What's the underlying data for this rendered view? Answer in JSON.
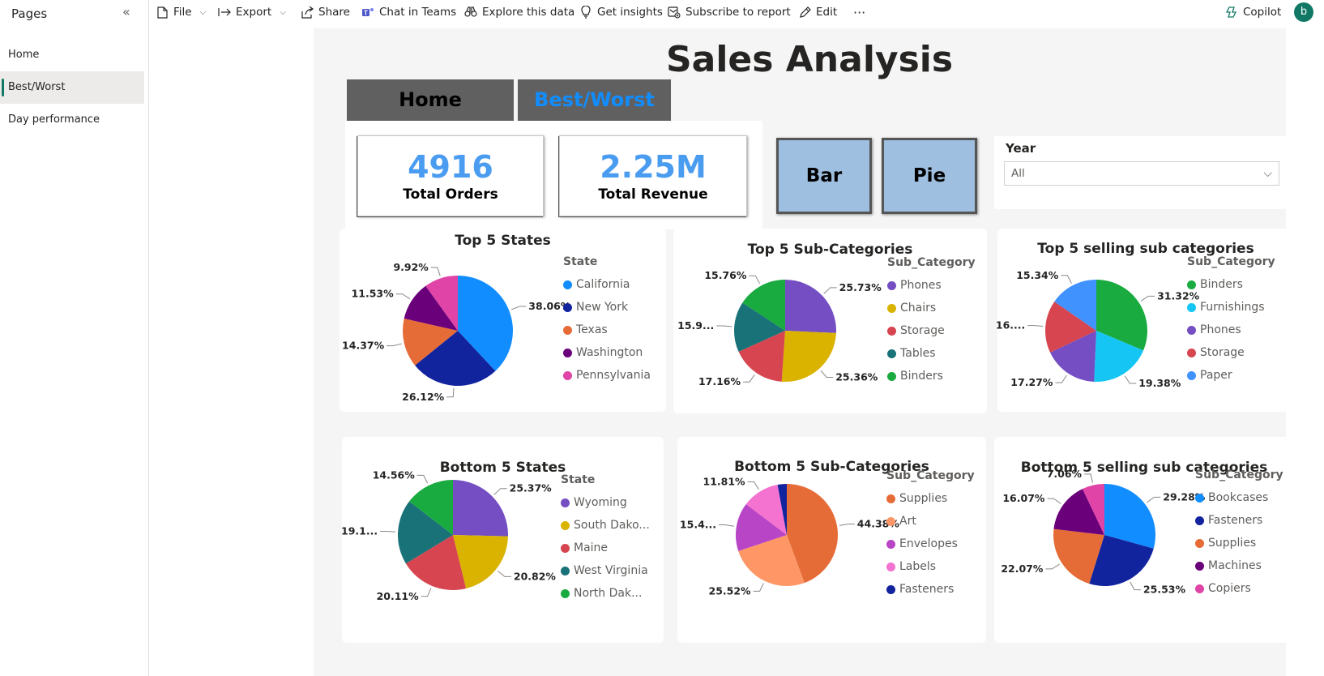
{
  "sidebar": {
    "title": "Pages",
    "items": [
      {
        "label": "Home",
        "active": false
      },
      {
        "label": "Best/Worst",
        "active": true
      },
      {
        "label": "Day performance",
        "active": false
      }
    ]
  },
  "toolbar": {
    "file": "File",
    "export": "Export",
    "share": "Share",
    "chat": "Chat in Teams",
    "explore": "Explore this data",
    "insights": "Get insights",
    "subscribe": "Subscribe to report",
    "edit": "Edit",
    "more": "···",
    "copilot": "Copilot",
    "avatar": "b"
  },
  "report": {
    "title": "Sales Analysis",
    "nav": {
      "home": "Home",
      "bestworst": "Best/Worst"
    },
    "kpis": [
      {
        "value": "4916",
        "label": "Total Orders"
      },
      {
        "value": "2.25M",
        "label": "Total Revenue"
      }
    ],
    "toggles": {
      "bar": "Bar",
      "pie": "Pie"
    },
    "slicer": {
      "title": "Year",
      "value": "All"
    }
  },
  "colors": {
    "accent": "#118dff",
    "kpi_value": "#4a9cf0",
    "toggle_bg": "#9fbfe0",
    "nav_bg": "#606060",
    "brand": "#117865"
  },
  "chart_data": [
    {
      "type": "pie",
      "title": "Top 5 States",
      "legend_title": "State",
      "categories": [
        "California",
        "New York",
        "Texas",
        "Washington",
        "Pennsylvania"
      ],
      "values": [
        38.06,
        26.12,
        14.37,
        11.53,
        9.92
      ],
      "labels": [
        "38.06%",
        "26.12%",
        "14.37%",
        "11.53%",
        "9.92%"
      ],
      "colors": [
        "#118dff",
        "#12239e",
        "#e66c37",
        "#6b007b",
        "#e044a7"
      ]
    },
    {
      "type": "pie",
      "title": "Top 5 Sub-Categories",
      "legend_title": "Sub_Category",
      "categories": [
        "Phones",
        "Chairs",
        "Storage",
        "Tables",
        "Binders"
      ],
      "values": [
        25.73,
        25.36,
        17.16,
        15.99,
        15.76
      ],
      "labels": [
        "25.73%",
        "25.36%",
        "17.16%",
        "15.9...",
        "15.76%"
      ],
      "colors": [
        "#744ec2",
        "#d9b300",
        "#d64550",
        "#197278",
        "#1aab40"
      ]
    },
    {
      "type": "pie",
      "title": "Top 5 selling sub categories",
      "legend_title": "Sub_Category",
      "categories": [
        "Binders",
        "Furnishings",
        "Phones",
        "Storage",
        "Paper"
      ],
      "values": [
        31.32,
        19.38,
        17.27,
        16.69,
        15.34
      ],
      "labels": [
        "31.32%",
        "19.38%",
        "17.27%",
        "16....",
        "15.34%"
      ],
      "colors": [
        "#1aab40",
        "#15c6f4",
        "#744ec2",
        "#d64550",
        "#4092ff"
      ]
    },
    {
      "type": "pie",
      "title": "Bottom 5 States",
      "legend_title": "State",
      "categories": [
        "Wyoming",
        "South Dako...",
        "Maine",
        "West Virginia",
        "North Dak..."
      ],
      "values": [
        25.37,
        20.82,
        20.11,
        19.14,
        14.56
      ],
      "labels": [
        "25.37%",
        "20.82%",
        "20.11%",
        "19.1...",
        "14.56%"
      ],
      "colors": [
        "#744ec2",
        "#d9b300",
        "#d64550",
        "#197278",
        "#1aab40"
      ]
    },
    {
      "type": "pie",
      "title": "Bottom 5 Sub-Categories",
      "legend_title": "Sub_Category",
      "categories": [
        "Supplies",
        "Art",
        "Envelopes",
        "Labels",
        "Fasteners"
      ],
      "values": [
        44.38,
        25.52,
        15.4,
        11.81,
        2.89
      ],
      "labels": [
        "44.38%",
        "25.52%",
        "15.4...",
        "11.81%",
        ""
      ],
      "colors": [
        "#e66c37",
        "#fe9666",
        "#b845c6",
        "#f472d0",
        "#12239e"
      ]
    },
    {
      "type": "pie",
      "title": "Bottom 5 selling sub categories",
      "legend_title": "Sub_Category",
      "categories": [
        "Bookcases",
        "Fasteners",
        "Supplies",
        "Machines",
        "Copiers"
      ],
      "values": [
        29.28,
        25.53,
        22.07,
        16.07,
        7.06
      ],
      "labels": [
        "29.28%",
        "25.53%",
        "22.07%",
        "16.07%",
        "7.06%"
      ],
      "colors": [
        "#118dff",
        "#12239e",
        "#e66c37",
        "#6b007b",
        "#e044a7"
      ]
    }
  ]
}
